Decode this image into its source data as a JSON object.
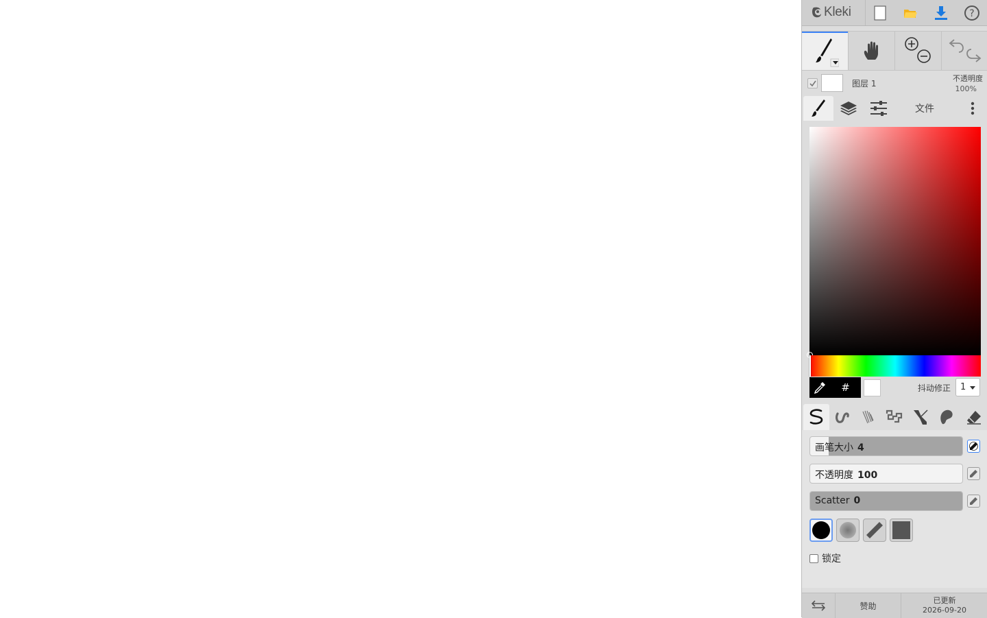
{
  "app": {
    "logo_text": "Kleki"
  },
  "topbar": {
    "icons": [
      "new-file-icon",
      "open-folder-icon",
      "download-icon",
      "help-icon"
    ]
  },
  "toolbar": {
    "tools": [
      "brush-tool-icon",
      "hand-tool-icon",
      "zoom-icon",
      "undo-redo-icon"
    ]
  },
  "layer": {
    "name": "图层 1",
    "opacity_label": "不透明度",
    "opacity_value": "100%"
  },
  "tabs": {
    "file_label": "文件"
  },
  "color": {
    "primary": "#000000",
    "secondary": "#ffffff",
    "hue_color": "#ff0000",
    "hex_label": "#",
    "stabilizer_label": "抖动修正",
    "stabilizer_value": "1"
  },
  "brush": {
    "size_label": "画笔大小",
    "size_value": "4",
    "size_fraction": 0.12,
    "opacity_label": "不透明度",
    "opacity_value": "100",
    "opacity_fraction": 1.0,
    "scatter_label": "Scatter",
    "scatter_value": "0",
    "scatter_fraction": 0.0,
    "lock_label": "锁定"
  },
  "footer": {
    "sponsor_label": "赞助",
    "updated_label": "已更新",
    "updated_date": "2026-09-20"
  },
  "accent": "#3b82f6"
}
